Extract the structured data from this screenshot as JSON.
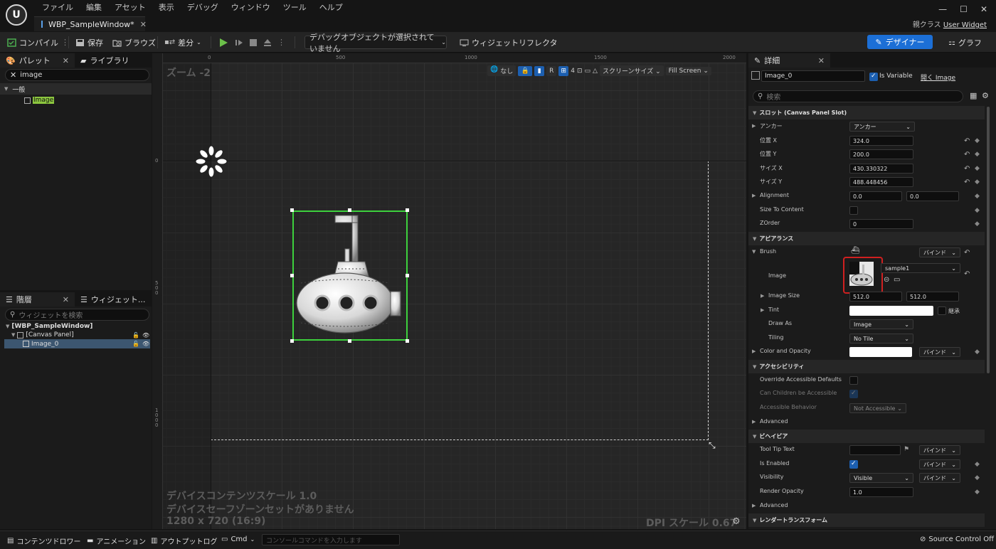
{
  "app": {
    "logo": "U",
    "menu": [
      "ファイル",
      "編集",
      "アセット",
      "表示",
      "デバッグ",
      "ウィンドウ",
      "ツール",
      "ヘルプ"
    ],
    "doc_tab": "WBP_SampleWindow*",
    "parent_class_label": "親クラス",
    "parent_class_value": "User Widget",
    "window_controls": [
      "—",
      "☐",
      "✕"
    ]
  },
  "toolbar": {
    "compile": "コンパイル",
    "save": "保存",
    "browse": "ブラウズ",
    "diff": "差分",
    "debug_object": "デバッグオブジェクトが選択されていません",
    "widget_reflector": "ウィジェットリフレクタ",
    "designer": "デザイナー",
    "graph": "グラフ"
  },
  "palette": {
    "tab_palette": "パレット",
    "tab_library": "ライブラリ",
    "search_value": "image",
    "category": "一般",
    "item": "Image"
  },
  "hierarchy": {
    "tab_hierarchy": "階層",
    "tab_widgets": "ウィジェット...",
    "search_placeholder": "ウィジェットを検索",
    "root": "[WBP_SampleWindow]",
    "canvas": "[Canvas Panel]",
    "image": "Image_0"
  },
  "viewport": {
    "zoom": "ズーム -2",
    "none_label": "なし",
    "r_label": "R",
    "grid_num": "4",
    "screen_size": "スクリーンサイズ",
    "fill_screen": "Fill Screen",
    "ruler_top": [
      "0",
      "500",
      "1000",
      "1500",
      "2000"
    ],
    "ruler_left": [
      "0",
      "500",
      "1000"
    ],
    "info_scale": "デバイスコンテンツスケール 1.0",
    "info_safezone": "デバイスセーフゾーンセットがありません",
    "info_resolution": "1280 x 720 (16:9)",
    "dpi": "DPI スケール 0.67"
  },
  "details": {
    "tab": "詳細",
    "name": "Image_0",
    "is_variable": "Is Variable",
    "open_image": "開く Image",
    "search_placeholder": "検索",
    "sec_slot": "スロット (Canvas Panel Slot)",
    "anchor_label": "アンカー",
    "anchor_value": "アンカー",
    "pos_x_label": "位置 X",
    "pos_x": "324.0",
    "pos_y_label": "位置 Y",
    "pos_y": "200.0",
    "size_x_label": "サイズ X",
    "size_x": "430.330322",
    "size_y_label": "サイズ Y",
    "size_y": "488.448456",
    "alignment_label": "Alignment",
    "alignment_x": "0.0",
    "alignment_y": "0.0",
    "size_to_content": "Size To Content",
    "zorder_label": "ZOrder",
    "zorder": "0",
    "sec_appearance": "アピアランス",
    "brush": "Brush",
    "bind": "バインド",
    "image_label": "Image",
    "image_asset": "sample1",
    "image_size_label": "Image Size",
    "image_size_x": "512.0",
    "image_size_y": "512.0",
    "tint": "Tint",
    "inherit": "継承",
    "draw_as_label": "Draw As",
    "draw_as": "Image",
    "tiling_label": "Tiling",
    "tiling": "No Tile",
    "color_opacity": "Color and Opacity",
    "sec_accessibility": "アクセシビリティ",
    "override_accessible": "Override Accessible Defaults",
    "can_children": "Can Children be Accessible",
    "accessible_behavior": "Accessible Behavior",
    "not_accessible": "Not Accessible",
    "advanced": "Advanced",
    "sec_behavior": "ビヘイビア",
    "tooltip": "Tool Tip Text",
    "is_enabled": "Is Enabled",
    "visibility_label": "Visibility",
    "visibility": "Visible",
    "render_opacity_label": "Render Opacity",
    "render_opacity": "1.0",
    "advanced2": "Advanced",
    "sec_render": "レンダートランスフォーム"
  },
  "statusbar": {
    "content_drawer": "コンテンツドロワー",
    "animation": "アニメーション",
    "output_log": "アウトプットログ",
    "cmd": "Cmd",
    "console_placeholder": "コンソールコマンドを入力します",
    "source_control": "Source Control Off"
  }
}
